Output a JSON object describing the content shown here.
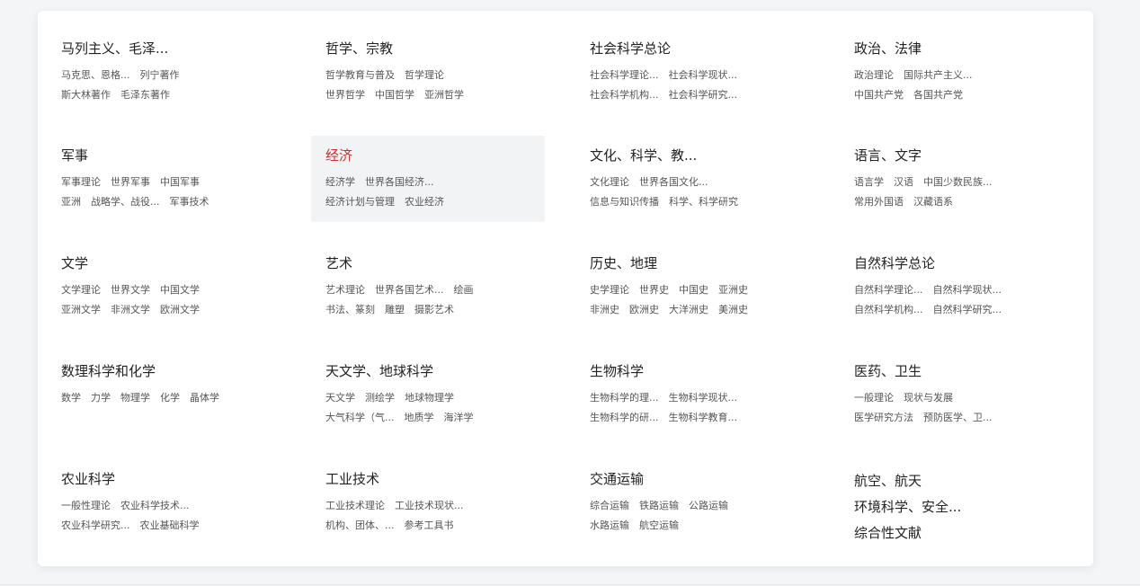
{
  "categories": [
    {
      "title": "马列主义、毛泽...",
      "rows": [
        [
          "马克思、恩格...",
          "列宁著作"
        ],
        [
          "斯大林著作",
          "毛泽东著作"
        ]
      ]
    },
    {
      "title": "哲学、宗教",
      "rows": [
        [
          "哲学教育与普及",
          "哲学理论"
        ],
        [
          "世界哲学",
          "中国哲学",
          "亚洲哲学"
        ]
      ]
    },
    {
      "title": "社会科学总论",
      "rows": [
        [
          "社会科学理论...",
          "社会科学现状..."
        ],
        [
          "社会科学机构...",
          "社会科学研究..."
        ]
      ]
    },
    {
      "title": "政治、法律",
      "rows": [
        [
          "政治理论",
          "国际共产主义..."
        ],
        [
          "中国共产党",
          "各国共产党"
        ]
      ]
    },
    {
      "title": "军事",
      "rows": [
        [
          "军事理论",
          "世界军事",
          "中国军事"
        ],
        [
          "亚洲",
          "战略学、战役...",
          "军事技术"
        ]
      ]
    },
    {
      "title": "经济",
      "rows": [
        [
          "经济学",
          "世界各国经济..."
        ],
        [
          "经济计划与管理",
          "农业经济"
        ]
      ]
    },
    {
      "title": "文化、科学、教...",
      "rows": [
        [
          "文化理论",
          "世界各国文化..."
        ],
        [
          "信息与知识传播",
          "科学、科学研究"
        ]
      ]
    },
    {
      "title": "语言、文字",
      "rows": [
        [
          "语言学",
          "汉语",
          "中国少数民族..."
        ],
        [
          "常用外国语",
          "汉藏语系"
        ]
      ]
    },
    {
      "title": "文学",
      "rows": [
        [
          "文学理论",
          "世界文学",
          "中国文学"
        ],
        [
          "亚洲文学",
          "非洲文学",
          "欧洲文学"
        ]
      ]
    },
    {
      "title": "艺术",
      "rows": [
        [
          "艺术理论",
          "世界各国艺术...",
          "绘画"
        ],
        [
          "书法、篆刻",
          "雕塑",
          "摄影艺术"
        ]
      ]
    },
    {
      "title": "历史、地理",
      "rows": [
        [
          "史学理论",
          "世界史",
          "中国史",
          "亚洲史"
        ],
        [
          "非洲史",
          "欧洲史",
          "大洋洲史",
          "美洲史"
        ]
      ]
    },
    {
      "title": "自然科学总论",
      "rows": [
        [
          "自然科学理论...",
          "自然科学现状..."
        ],
        [
          "自然科学机构...",
          "自然科学研究..."
        ]
      ]
    },
    {
      "title": "数理科学和化学",
      "rows": [
        [
          "数学",
          "力学",
          "物理学",
          "化学",
          "晶体学"
        ]
      ]
    },
    {
      "title": "天文学、地球科学",
      "rows": [
        [
          "天文学",
          "测绘学",
          "地球物理学"
        ],
        [
          "大气科学（气...",
          "地质学",
          "海洋学"
        ]
      ]
    },
    {
      "title": "生物科学",
      "rows": [
        [
          "生物科学的理...",
          "生物科学现状..."
        ],
        [
          "生物科学的研...",
          "生物科学教育..."
        ]
      ]
    },
    {
      "title": "医药、卫生",
      "rows": [
        [
          "一般理论",
          "现状与发展"
        ],
        [
          "医学研究方法",
          "预防医学、卫..."
        ]
      ]
    },
    {
      "title": "农业科学",
      "rows": [
        [
          "一般性理论",
          "农业科学技术..."
        ],
        [
          "农业科学研究...",
          "农业基础科学"
        ]
      ]
    },
    {
      "title": "工业技术",
      "rows": [
        [
          "工业技术理论",
          "工业技术现状..."
        ],
        [
          "机构、团体、...",
          "参考工具书"
        ]
      ]
    },
    {
      "title": "交通运输",
      "rows": [
        [
          "综合运输",
          "铁路运输",
          "公路运输"
        ],
        [
          "水路运输",
          "航空运输"
        ]
      ]
    }
  ],
  "extra_titles": [
    "航空、航天",
    "环境科学、安全...",
    "综合性文献"
  ],
  "colors": {
    "active_title": "#d0312d",
    "active_bg": "#f2f3f5"
  }
}
